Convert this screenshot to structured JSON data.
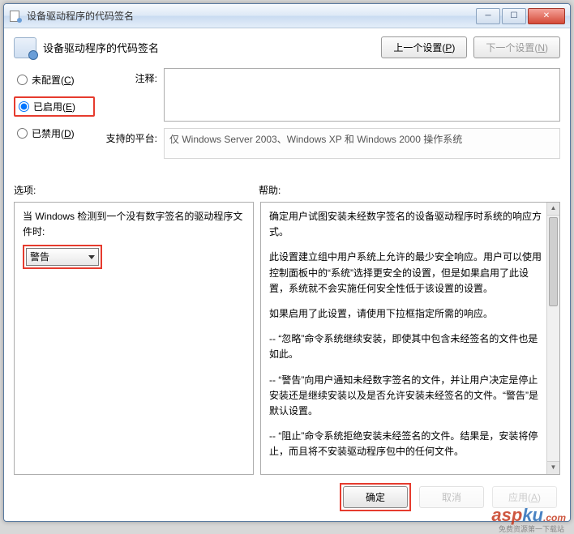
{
  "title": "设备驱动程序的代码签名",
  "header": {
    "title": "设备驱动程序的代码签名",
    "prev_label": "上一个设置(P)",
    "next_label": "下一个设置(N)"
  },
  "radios": {
    "not_configured": "未配置(C)",
    "enabled": "已启用(E)",
    "disabled": "已禁用(D)"
  },
  "annotation": {
    "label": "注释:",
    "value": ""
  },
  "platform": {
    "label": "支持的平台:",
    "value": "仅 Windows Server 2003、Windows XP 和 Windows 2000 操作系统"
  },
  "sections": {
    "options_label": "选项:",
    "help_label": "帮助:"
  },
  "options": {
    "prompt": "当 Windows 检测到一个没有数字签名的驱动程序文件时:",
    "combo_value": "警告"
  },
  "help": {
    "p1": "确定用户试图安装未经数字签名的设备驱动程序时系统的响应方式。",
    "p2": "此设置建立组中用户系统上允许的最少安全响应。用户可以使用控制面板中的“系统”选择更安全的设置，但是如果启用了此设置，系统就不会实施任何安全性低于该设置的设置。",
    "p3": "如果启用了此设置，请使用下拉框指定所需的响应。",
    "p4": "-- “忽略”命令系统继续安装，即使其中包含未经签名的文件也是如此。",
    "p5": "-- “警告”向用户通知未经数字签名的文件，并让用户决定是停止安装还是继续安装以及是否允许安装未经签名的文件。“警告”是默认设置。",
    "p6": "-- “阻止”命令系统拒绝安装未经签名的文件。结果是，安装将停止，而且将不安装驱动程序包中的任何文件。"
  },
  "footer": {
    "ok": "确定",
    "cancel": "取消",
    "apply": "应用(A)"
  },
  "watermark": {
    "main_a": "asp",
    "main_b": "ku",
    "suffix": ".com",
    "sub": "免费资源第一下载站"
  }
}
